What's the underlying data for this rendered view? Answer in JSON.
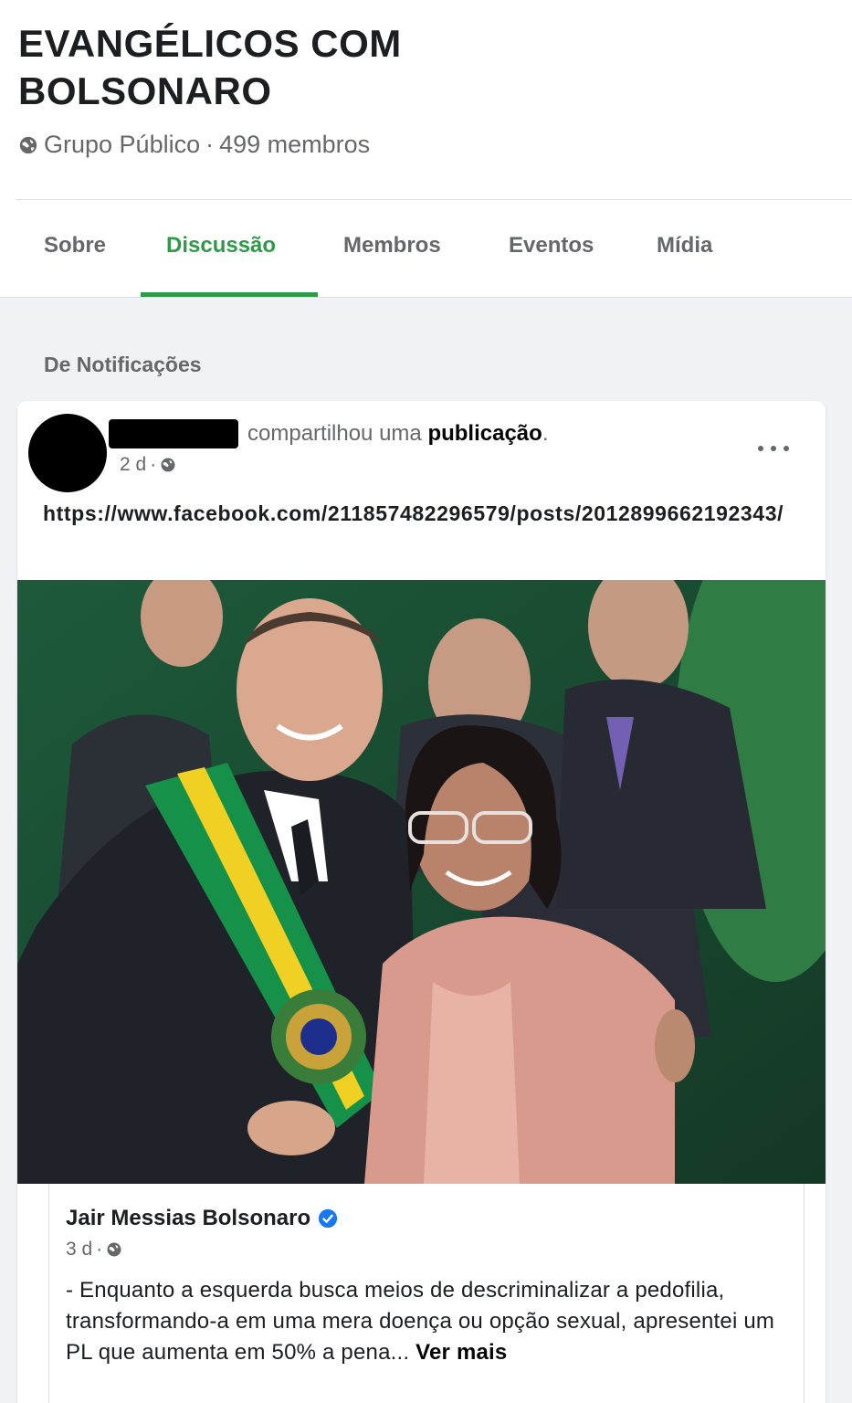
{
  "group": {
    "title_line1": "EVANGÉLICOS COM",
    "title_line2": "BOLSONARO",
    "privacy": "Grupo Público",
    "separator": "·",
    "members": "499 membros"
  },
  "tabs": [
    {
      "label": "Sobre",
      "active": false
    },
    {
      "label": "Discussão",
      "active": true
    },
    {
      "label": "Membros",
      "active": false
    },
    {
      "label": "Eventos",
      "active": false
    },
    {
      "label": "Mídia",
      "active": false
    }
  ],
  "section_label": "De Notificações",
  "post": {
    "action_text": "compartilhou uma",
    "action_object": "publicação",
    "action_end": ".",
    "time": "2 d",
    "time_separator": "·",
    "link": "https://www.facebook.com/211857482296579/posts/2012899662192343/",
    "embedded": {
      "author": "Jair Messias Bolsonaro",
      "time": "3 d",
      "time_separator": "·",
      "text": "- Enquanto a esquerda busca meios de descriminalizar a pedofilia, transformando-a em uma mera doença ou opção sexual, apresentei um PL que aumenta em 50% a pena...",
      "see_more": "Ver mais"
    }
  },
  "colors": {
    "accent": "#2e9a48",
    "muted_text": "#65676b",
    "verified": "#1877f2"
  }
}
